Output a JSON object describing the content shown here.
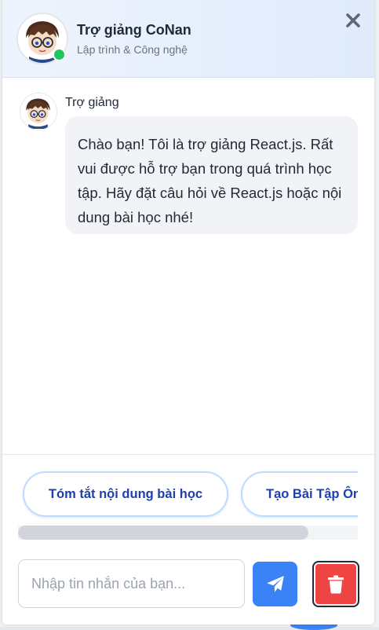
{
  "header": {
    "title": "Trợ giảng CoNan",
    "subtitle": "Lập trình & Công nghệ",
    "avatar_icon": "conan-avatar-icon",
    "status_color": "#22c55e",
    "close_icon": "close-x-icon"
  },
  "messages": [
    {
      "sender": "Trợ giảng",
      "text": "Chào bạn! Tôi là trợ giảng React.js. Rất vui được hỗ trợ bạn trong quá trình học tập. Hãy đặt câu hỏi về React.js hoặc nội dung bài học nhé!"
    }
  ],
  "suggestions": [
    {
      "label": "Tóm tắt nội dung bài học"
    },
    {
      "label": "Tạo Bài Tập Ôn"
    }
  ],
  "composer": {
    "placeholder": "Nhập tin nhắn của bạn...",
    "send_icon": "paper-plane-icon",
    "delete_icon": "trash-icon"
  },
  "colors": {
    "accent": "#3b82f6",
    "danger": "#ef4444",
    "chip_text": "#1e40af",
    "chip_border": "#bfdbfe"
  }
}
